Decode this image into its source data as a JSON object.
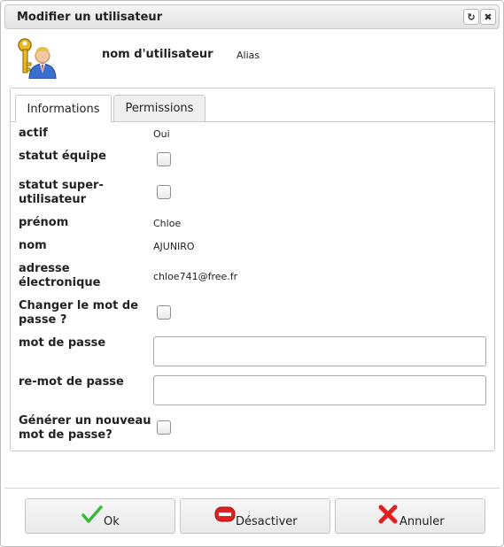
{
  "dialog": {
    "title": "Modifier un utilisateur",
    "refresh_icon": "refresh-icon",
    "close_icon": "close-icon"
  },
  "header": {
    "icon": "user-key-icon",
    "label": "nom d'utilisateur",
    "value": "Alias"
  },
  "tabs": [
    {
      "label": "Informations",
      "active": true
    },
    {
      "label": "Permissions",
      "active": false
    }
  ],
  "form": {
    "actif": {
      "label": "actif",
      "value": "Oui"
    },
    "statut_equipe": {
      "label": "statut équipe",
      "checked": false
    },
    "statut_super": {
      "label_line1": "statut super-",
      "label_line2": "utilisateur",
      "checked": false
    },
    "prenom": {
      "label": "prénom",
      "value": "Chloe"
    },
    "nom": {
      "label": "nom",
      "value": "AJUNIRO"
    },
    "email": {
      "label_line1": "adresse",
      "label_line2": "électronique",
      "value": "chloe741@free.fr"
    },
    "changer_mdp": {
      "label_line1": "Changer le mot de",
      "label_line2": "passe ?",
      "checked": false
    },
    "mot_de_passe": {
      "label": "mot de passe",
      "value": ""
    },
    "re_mot_de_passe": {
      "label": "re-mot de passe",
      "value": ""
    },
    "generer_mdp": {
      "label_line1": "Générer un nouveau",
      "label_line2": "mot de passe?",
      "checked": false
    }
  },
  "buttons": {
    "ok": {
      "label": "Ok",
      "icon": "checkmark-icon",
      "color": "#3bb83b"
    },
    "deactivate": {
      "label": "Désactiver",
      "icon": "minus-circle-icon",
      "color": "#e02020"
    },
    "cancel": {
      "label": "Annuler",
      "icon": "cross-icon",
      "color": "#e02020"
    }
  }
}
